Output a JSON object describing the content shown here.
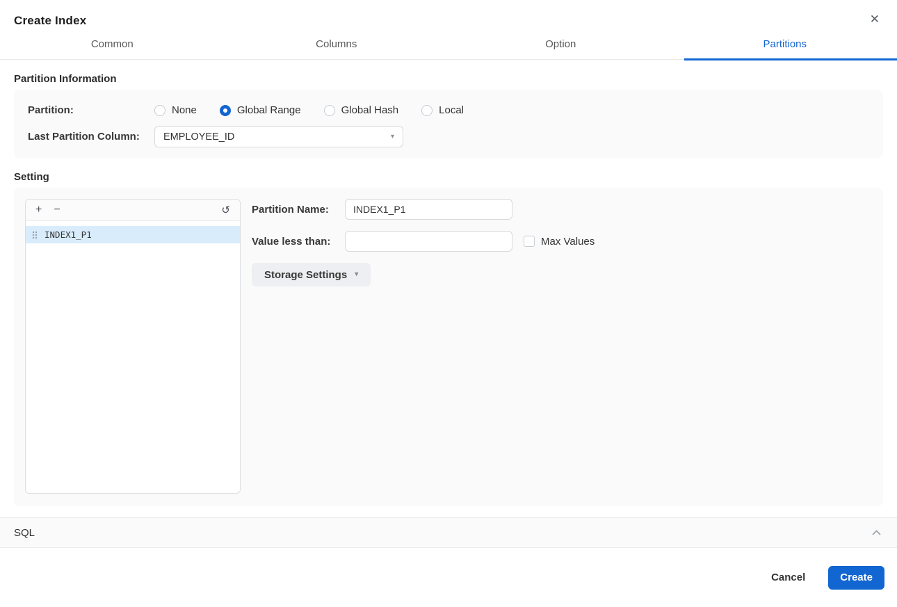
{
  "dialog": {
    "title": "Create Index"
  },
  "icons": {
    "close": "✕",
    "add": "+",
    "remove": "−",
    "refresh": "↺",
    "caret_down": "▾"
  },
  "tabs": [
    {
      "label": "Common",
      "active": false
    },
    {
      "label": "Columns",
      "active": false
    },
    {
      "label": "Option",
      "active": false
    },
    {
      "label": "Partitions",
      "active": true
    }
  ],
  "partition_information": {
    "heading": "Partition Information",
    "partition_label": "Partition:",
    "options": [
      {
        "label": "None",
        "selected": false
      },
      {
        "label": "Global Range",
        "selected": true
      },
      {
        "label": "Global Hash",
        "selected": false
      },
      {
        "label": "Local",
        "selected": false
      }
    ],
    "last_partition_column_label": "Last Partition Column:",
    "last_partition_column_value": "EMPLOYEE_ID"
  },
  "setting": {
    "heading": "Setting",
    "partition_list": {
      "items": [
        {
          "name": "INDEX1_P1",
          "selected": true
        }
      ]
    },
    "form": {
      "partition_name_label": "Partition Name:",
      "partition_name_value": "INDEX1_P1",
      "value_less_than_label": "Value less than:",
      "value_less_than_value": "",
      "max_values_label": "Max Values",
      "max_values_checked": false,
      "storage_settings_label": "Storage Settings"
    }
  },
  "sql_section": {
    "label": "SQL",
    "collapsed": false
  },
  "footer": {
    "cancel_label": "Cancel",
    "create_label": "Create"
  },
  "colors": {
    "primary": "#1266d1",
    "selected_row_bg": "#d9ecfb",
    "panel_bg": "#fafafa",
    "border": "#e9e9e9",
    "input_border": "#d9d9d9"
  }
}
